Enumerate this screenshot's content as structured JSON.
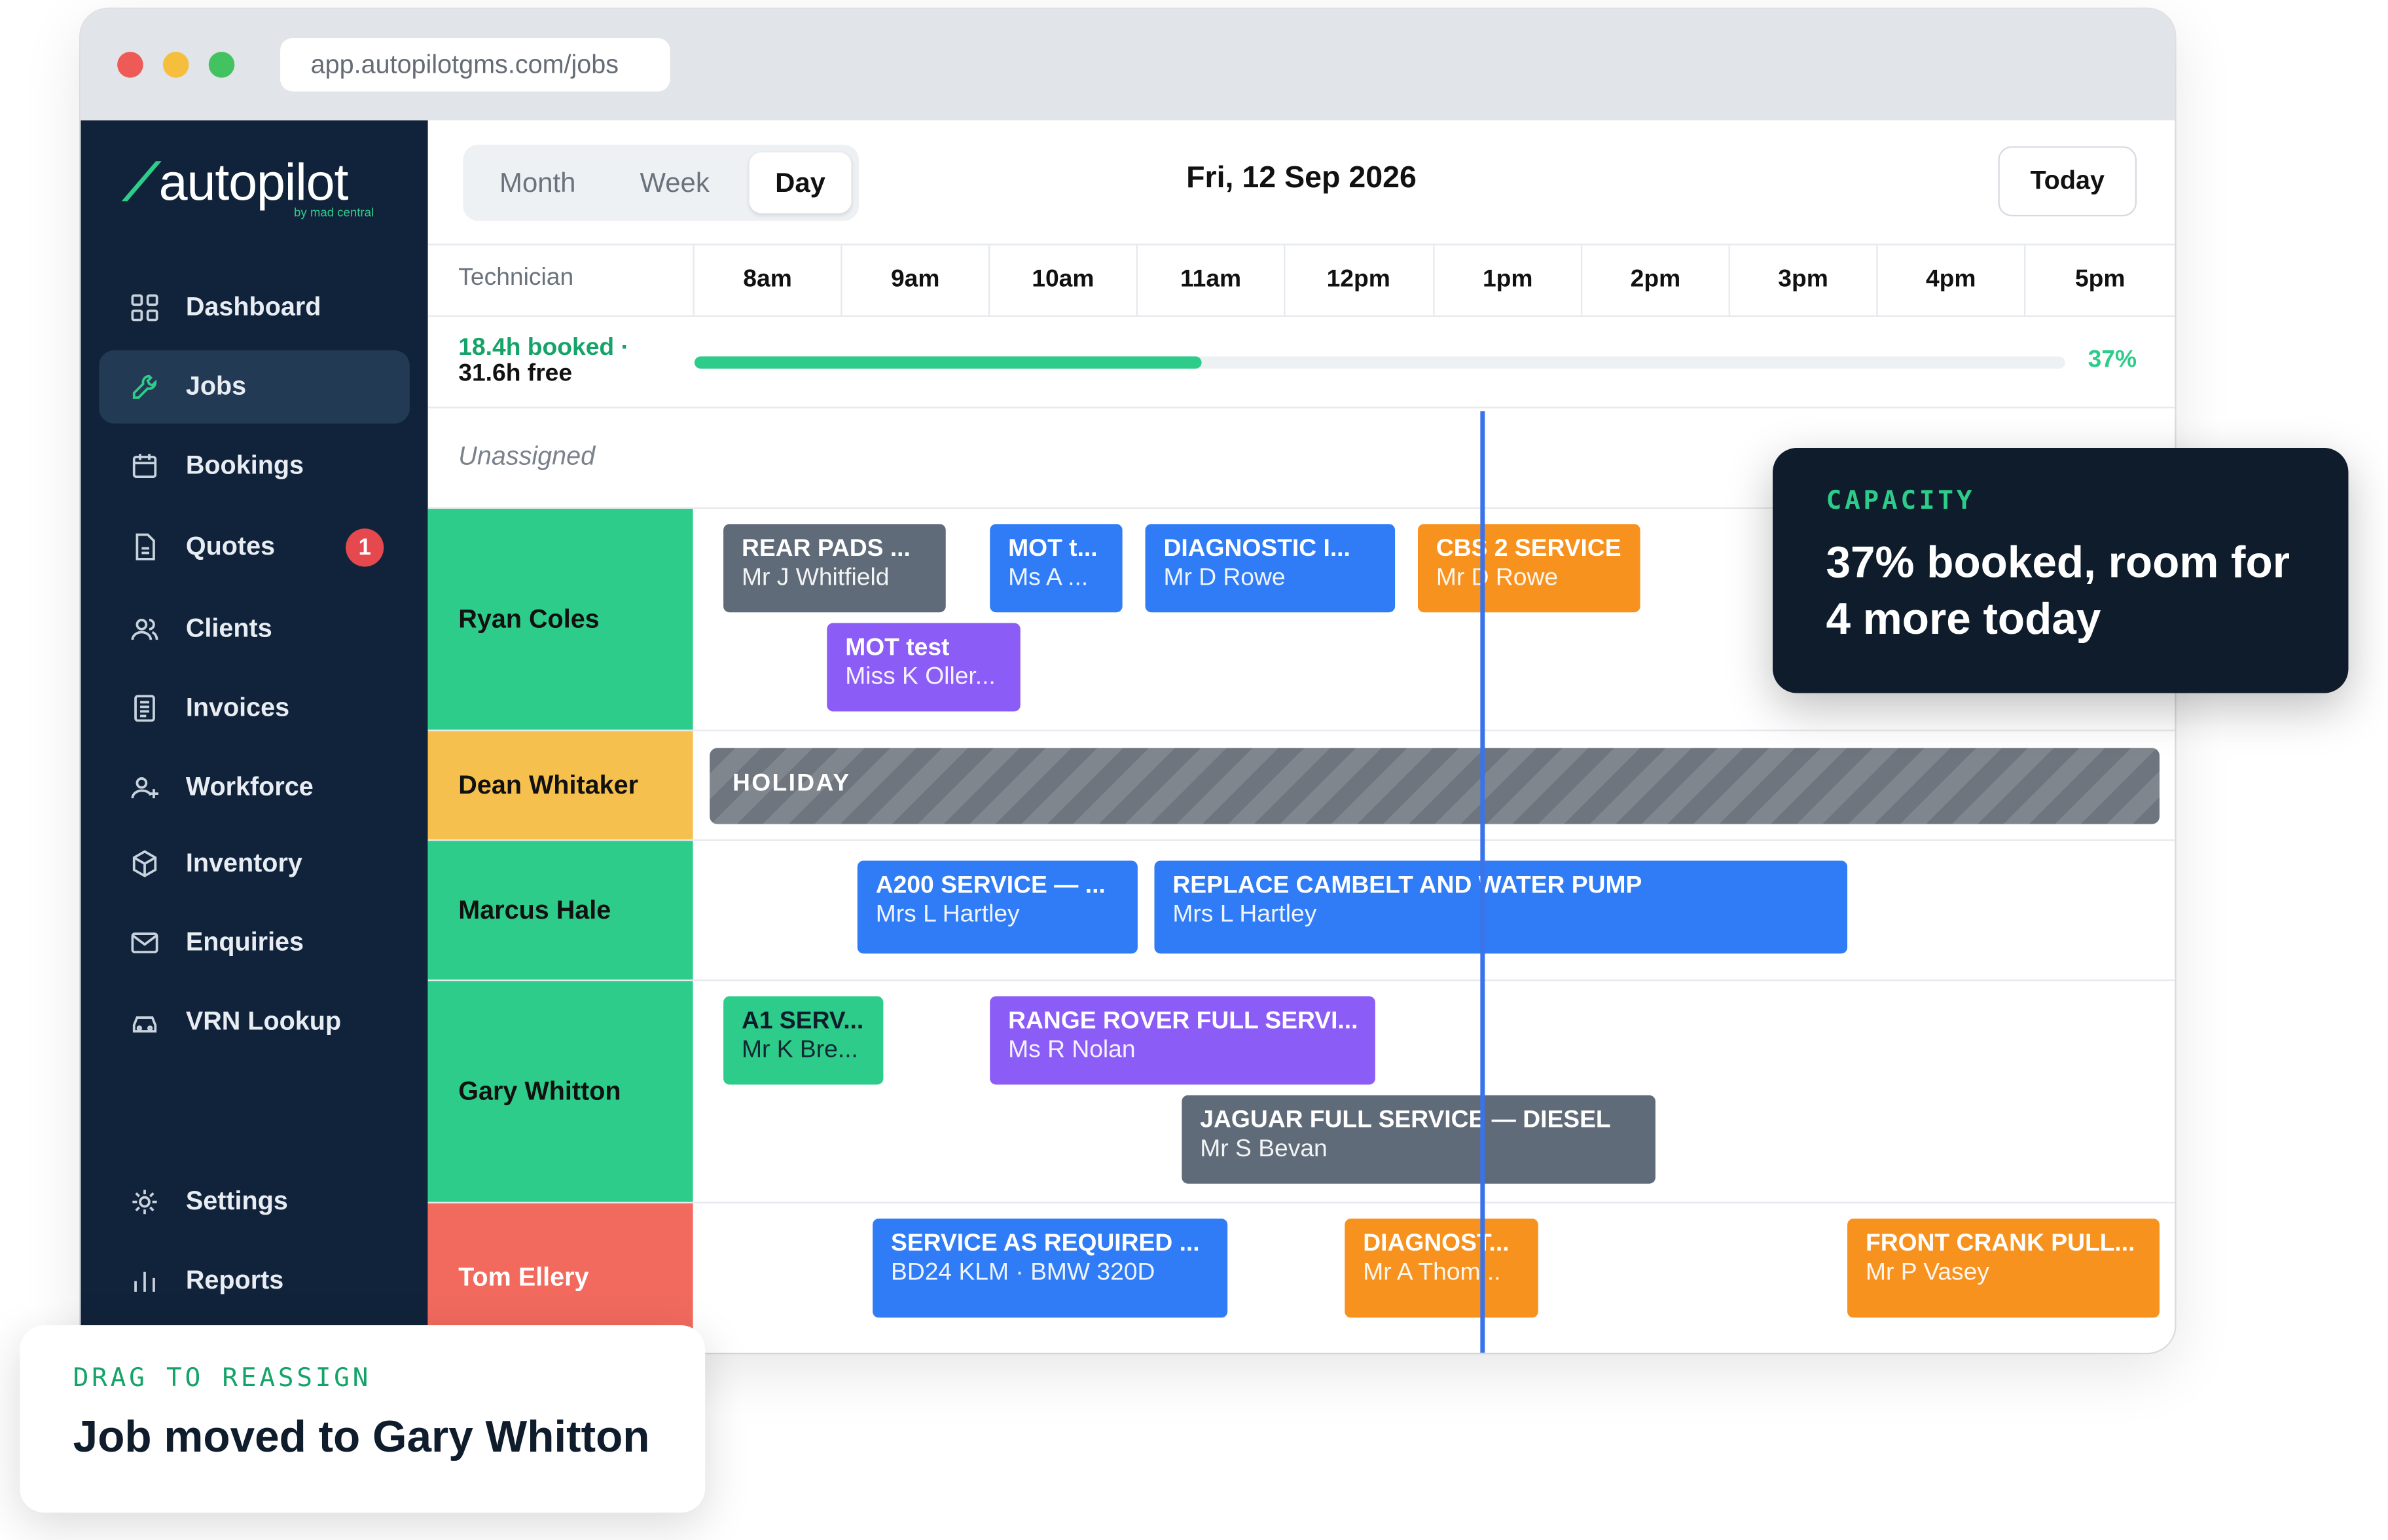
{
  "browser": {
    "url": "app.autopilotgms.com/jobs"
  },
  "brand": {
    "name": "autopilot",
    "tagline": "by mad central"
  },
  "sidebar": {
    "items": [
      {
        "label": "Dashboard",
        "icon": "grid-icon"
      },
      {
        "label": "Jobs",
        "icon": "wrench-icon",
        "active": true
      },
      {
        "label": "Bookings",
        "icon": "calendar-icon"
      },
      {
        "label": "Quotes",
        "icon": "document-icon",
        "badge": "1"
      },
      {
        "label": "Clients",
        "icon": "users-icon"
      },
      {
        "label": "Invoices",
        "icon": "invoice-icon"
      },
      {
        "label": "Workforce",
        "icon": "user-plus-icon"
      },
      {
        "label": "Inventory",
        "icon": "box-icon"
      },
      {
        "label": "Enquiries",
        "icon": "mail-icon"
      },
      {
        "label": "VRN Lookup",
        "icon": "car-icon"
      }
    ],
    "bottom_items": [
      {
        "label": "Settings",
        "icon": "gear-icon"
      },
      {
        "label": "Reports",
        "icon": "bar-chart-icon"
      }
    ]
  },
  "toolbar": {
    "views": [
      "Month",
      "Week",
      "Day"
    ],
    "selected_view": "Day",
    "date": "Fri, 12 Sep 2026",
    "today_label": "Today"
  },
  "grid": {
    "tech_header": "Technician",
    "hours": [
      "8am",
      "9am",
      "10am",
      "11am",
      "12pm",
      "1pm",
      "2pm",
      "3pm",
      "4pm",
      "5pm"
    ]
  },
  "capacity": {
    "booked": "18.4h booked ·",
    "free": "31.6h free",
    "percent_label": "37%",
    "fraction": 0.37
  },
  "unassigned_label": "Unassigned",
  "technicians": [
    {
      "name": "Ryan Coles",
      "color": "#2ecc8a"
    },
    {
      "name": "Dean Whitaker",
      "color": "#f5c04d"
    },
    {
      "name": "Marcus Hale",
      "color": "#2ecc8a"
    },
    {
      "name": "Gary Whitton",
      "color": "#2ecc8a"
    },
    {
      "name": "Tom Ellery",
      "color": "#f26a5e"
    }
  ],
  "holiday_label": "HOLIDAY",
  "jobs": {
    "ryan": [
      {
        "title": "REAR PADS ...",
        "sub": "Mr J Whitfield",
        "color": "#5f6b78"
      },
      {
        "title": "MOT t...",
        "sub": "Ms A ...",
        "color": "#2f7cf6"
      },
      {
        "title": "DIAGNOSTIC I...",
        "sub": "Mr D Rowe",
        "color": "#2f7cf6"
      },
      {
        "title": "CBS 2 SERVICE",
        "sub": "Mr D Rowe",
        "color": "#f7921e"
      },
      {
        "title": "MOT test",
        "sub": "Miss K Oller...",
        "color": "#8b5cf6"
      }
    ],
    "marcus": [
      {
        "title": "A200 SERVICE — ...",
        "sub": "Mrs L Hartley",
        "color": "#2f7cf6"
      },
      {
        "title": "REPLACE CAMBELT AND WATER PUMP",
        "sub": "Mrs L Hartley",
        "color": "#2f7cf6"
      }
    ],
    "gary": [
      {
        "title": "A1 SERV...",
        "sub": "Mr K Bre...",
        "color": "#2ecc8a"
      },
      {
        "title": "RANGE ROVER FULL SERVI...",
        "sub": "Ms R Nolan",
        "color": "#8b5cf6"
      },
      {
        "title": "JAGUAR FULL SERVICE — DIESEL",
        "sub": "Mr S Bevan",
        "color": "#5f6b78"
      }
    ],
    "tom": [
      {
        "title": "SERVICE AS REQUIRED ...",
        "sub": "BD24 KLM · BMW 320D",
        "color": "#2f7cf6"
      },
      {
        "title": "DIAGNOST...",
        "sub": "Mr A Thom...",
        "color": "#f7921e"
      },
      {
        "title": "FRONT CRANK PULL...",
        "sub": "Mr P Vasey",
        "color": "#f7921e"
      }
    ]
  },
  "capacity_callout": {
    "kicker": "CAPACITY",
    "message": "37% booked, room for 4 more today"
  },
  "toast": {
    "kicker": "DRAG TO REASSIGN",
    "message": "Job moved to Gary Whitton"
  }
}
